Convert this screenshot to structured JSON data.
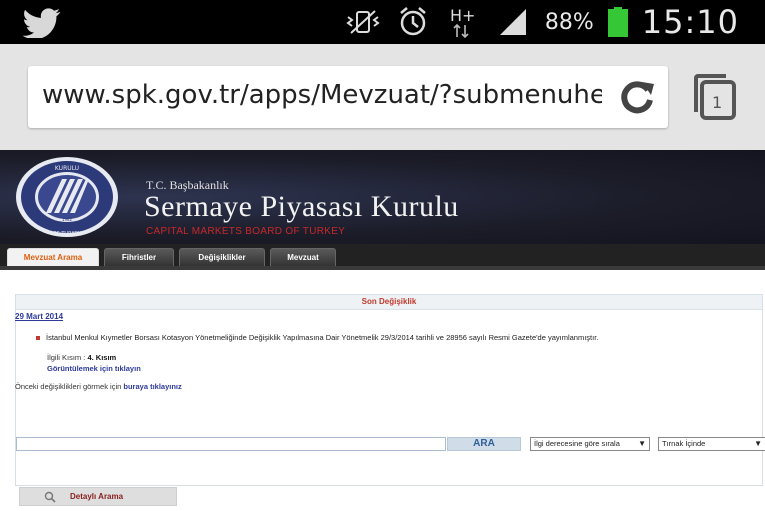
{
  "status_bar": {
    "battery_percent": "88%",
    "time": "15:10",
    "icons": [
      "twitter-bird-icon",
      "mute-vibrate-icon",
      "alarm-icon",
      "hplus-data-icon",
      "signal-icon",
      "battery-icon"
    ],
    "data_indicator": "H+",
    "battery_level": 0.88,
    "battery_color": "#36c736"
  },
  "browser": {
    "url": "www.spk.gov.tr/apps/Mevzuat/?submenuheade",
    "tab_count": "1"
  },
  "header": {
    "ministry": "T.C. Başbakanlık",
    "title": "Sermaye Piyasası Kurulu",
    "subtitle": "CAPITAL MARKETS BOARD OF TURKEY",
    "seal_text": "SERMAYE PİYASASI KURULU · CAPITAL MARKETS BOARD OF TURKEY",
    "seal_year": "1982"
  },
  "nav": {
    "tabs": [
      {
        "label": "Mevzuat Arama",
        "active": true
      },
      {
        "label": "Fihristler",
        "active": false
      },
      {
        "label": "Değişiklikler",
        "active": false
      },
      {
        "label": "Mevzuat",
        "active": false
      }
    ]
  },
  "panel": {
    "title": "Son Değişiklik",
    "date": "29 Mart 2014",
    "item_text": "İstanbul Menkul Kıymetler Borsası Kotasyon Yönetmeliğinde Değişiklik Yapılmasına Dair Yönetmelik 29/3/2014 tarihli ve 28956 sayılı Resmi Gazete'de yayımlanmıştır.",
    "ilgili_label": "İlgili Kısım :",
    "ilgili_value": "4. Kısım",
    "view_link": "Görüntülemek için tıklayın",
    "previous_prefix": "Önceki değişiklikleri görmek için",
    "previous_link": "buraya tıklayınız"
  },
  "search": {
    "input_value": "",
    "button_label": "ARA",
    "sort_select": "İlgi derecesine göre sırala",
    "mode_select": "Tırnak İçinde"
  },
  "detailed_search": {
    "label": "Detaylı Arama"
  },
  "colors": {
    "header_bg": "#1c1c2a",
    "accent_red": "#c0392b",
    "link_blue": "#2d3a9a",
    "active_tab_text": "#e06010"
  }
}
